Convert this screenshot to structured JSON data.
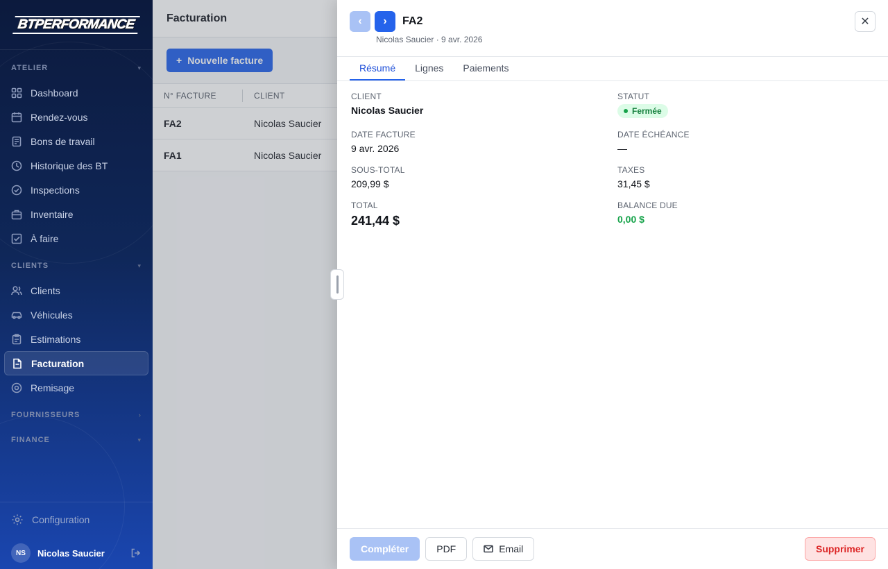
{
  "sidebar": {
    "logo": "BTPERFORMANCE",
    "sections": {
      "atelier": "ATELIER",
      "clients": "CLIENTS",
      "fournisseurs": "FOURNISSEURS",
      "finance": "FINANCE"
    },
    "atelier_items": [
      "Dashboard",
      "Rendez-vous",
      "Bons de travail",
      "Historique des BT",
      "Inspections",
      "Inventaire",
      "À faire"
    ],
    "clients_items": [
      "Clients",
      "Véhicules",
      "Estimations",
      "Facturation",
      "Remisage"
    ],
    "configuration": "Configuration",
    "user": {
      "initials": "NS",
      "name": "Nicolas Saucier"
    }
  },
  "main": {
    "title": "Facturation",
    "new_invoice": "Nouvelle facture",
    "columns": [
      "N° FACTURE",
      "CLIENT"
    ],
    "rows": [
      {
        "number": "FA2",
        "client": "Nicolas Saucier"
      },
      {
        "number": "FA1",
        "client": "Nicolas Saucier"
      }
    ]
  },
  "drawer": {
    "title": "FA2",
    "subtitle": "Nicolas Saucier · 9 avr. 2026",
    "tabs": [
      "Résumé",
      "Lignes",
      "Paiements"
    ],
    "fields": {
      "client_label": "CLIENT",
      "client_value": "Nicolas Saucier",
      "statut_label": "STATUT",
      "statut_value": "Fermée",
      "date_label": "DATE FACTURE",
      "date_value": "9 avr. 2026",
      "echeance_label": "DATE ÉCHÉANCE",
      "echeance_value": "—",
      "soustotal_label": "SOUS-TOTAL",
      "soustotal_value": "209,99 $",
      "taxes_label": "TAXES",
      "taxes_value": "31,45 $",
      "total_label": "TOTAL",
      "total_value": "241,44 $",
      "balance_label": "BALANCE DUE",
      "balance_value": "0,00 $"
    },
    "footer": {
      "complete": "Compléter",
      "pdf": "PDF",
      "email": "Email",
      "delete": "Supprimer"
    }
  },
  "colors": {
    "accent": "#2563eb",
    "success": "#16a34a",
    "danger": "#dc2626"
  }
}
